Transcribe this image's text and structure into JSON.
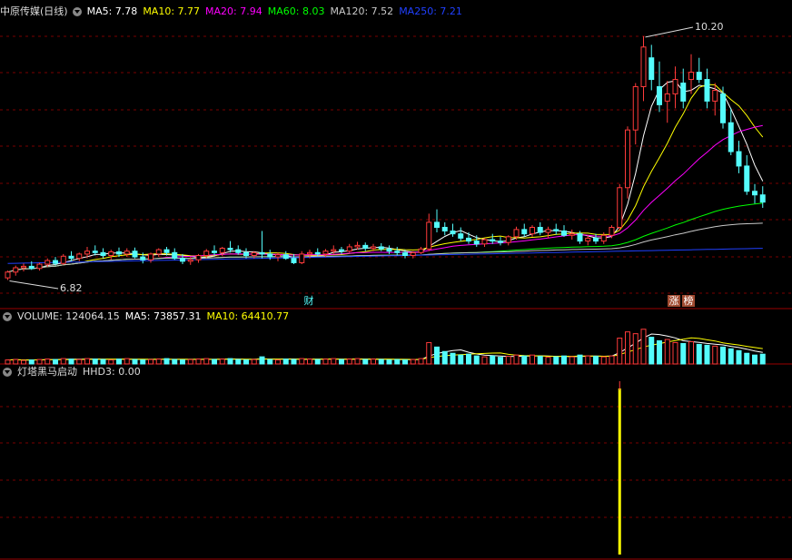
{
  "colors": {
    "up": "#ff3b3b",
    "down": "#54fcfc",
    "ma5": "#ffffff",
    "ma10": "#ffff00",
    "ma20": "#ff00ff",
    "ma60": "#00ff00",
    "ma120": "#c8c8c8",
    "ma250": "#2040ff",
    "grid": "#7a0000",
    "divider": "#9a0000",
    "signal": "#ffff00"
  },
  "price_panel": {
    "stock_name": "中原传媒(日线)",
    "ma5_label": "MA5: 7.78",
    "ma10_label": "MA10: 7.77",
    "ma20_label": "MA20: 7.94",
    "ma60_label": "MA60: 8.03",
    "ma120_label": "MA120: 7.52",
    "ma250_label": "MA250: 7.21",
    "high_mark": "10.20",
    "low_mark": "6.82",
    "event_cai": "财",
    "event_zhang": "涨",
    "event_bang": "榜"
  },
  "volume_panel": {
    "volume_label": "VOLUME: 124064.15",
    "ma5_label": "MA5: 73857.31",
    "ma10_label": "MA10: 64410.77"
  },
  "indicator_panel": {
    "name": "灯塔黑马启动",
    "hhd3_label": "HHD3: 0.00"
  },
  "chart_data": {
    "type": "candlestick",
    "title": "中原传媒(日线)",
    "ylim": [
      6.6,
      10.45
    ],
    "high": 10.2,
    "low": 6.82,
    "candles": [
      [
        6.85,
        6.95,
        6.82,
        6.93
      ],
      [
        6.93,
        7.02,
        6.88,
        6.99
      ],
      [
        6.99,
        7.05,
        6.94,
        7.01
      ],
      [
        7.01,
        7.08,
        6.96,
        6.98
      ],
      [
        6.98,
        7.06,
        6.95,
        7.04
      ],
      [
        7.04,
        7.12,
        7.0,
        7.09
      ],
      [
        7.09,
        7.14,
        7.02,
        7.05
      ],
      [
        7.05,
        7.18,
        7.03,
        7.15
      ],
      [
        7.15,
        7.22,
        7.08,
        7.12
      ],
      [
        7.12,
        7.2,
        7.08,
        7.18
      ],
      [
        7.18,
        7.28,
        7.12,
        7.22
      ],
      [
        7.22,
        7.3,
        7.16,
        7.2
      ],
      [
        7.2,
        7.26,
        7.12,
        7.16
      ],
      [
        7.16,
        7.24,
        7.1,
        7.21
      ],
      [
        7.21,
        7.27,
        7.14,
        7.18
      ],
      [
        7.18,
        7.26,
        7.14,
        7.22
      ],
      [
        7.22,
        7.27,
        7.12,
        7.14
      ],
      [
        7.14,
        7.2,
        7.05,
        7.1
      ],
      [
        7.1,
        7.2,
        7.06,
        7.18
      ],
      [
        7.18,
        7.26,
        7.14,
        7.24
      ],
      [
        7.24,
        7.28,
        7.16,
        7.2
      ],
      [
        7.2,
        7.26,
        7.1,
        7.12
      ],
      [
        7.12,
        7.18,
        7.04,
        7.08
      ],
      [
        7.08,
        7.14,
        7.03,
        7.1
      ],
      [
        7.1,
        7.18,
        7.06,
        7.16
      ],
      [
        7.16,
        7.25,
        7.12,
        7.22
      ],
      [
        7.22,
        7.3,
        7.16,
        7.2
      ],
      [
        7.2,
        7.28,
        7.15,
        7.26
      ],
      [
        7.26,
        7.36,
        7.2,
        7.24
      ],
      [
        7.24,
        7.3,
        7.17,
        7.2
      ],
      [
        7.2,
        7.26,
        7.12,
        7.16
      ],
      [
        7.16,
        7.22,
        7.12,
        7.2
      ],
      [
        7.2,
        7.5,
        7.12,
        7.18
      ],
      [
        7.18,
        7.24,
        7.1,
        7.14
      ],
      [
        7.14,
        7.2,
        7.08,
        7.17
      ],
      [
        7.17,
        7.22,
        7.1,
        7.12
      ],
      [
        7.12,
        7.18,
        7.04,
        7.06
      ],
      [
        7.06,
        7.22,
        7.04,
        7.18
      ],
      [
        7.18,
        7.24,
        7.12,
        7.2
      ],
      [
        7.2,
        7.26,
        7.15,
        7.18
      ],
      [
        7.18,
        7.25,
        7.14,
        7.22
      ],
      [
        7.22,
        7.3,
        7.18,
        7.24
      ],
      [
        7.24,
        7.28,
        7.18,
        7.22
      ],
      [
        7.22,
        7.32,
        7.2,
        7.28
      ],
      [
        7.28,
        7.35,
        7.24,
        7.3
      ],
      [
        7.3,
        7.34,
        7.22,
        7.26
      ],
      [
        7.26,
        7.32,
        7.22,
        7.28
      ],
      [
        7.28,
        7.33,
        7.22,
        7.25
      ],
      [
        7.25,
        7.3,
        7.18,
        7.22
      ],
      [
        7.22,
        7.28,
        7.16,
        7.2
      ],
      [
        7.2,
        7.24,
        7.12,
        7.16
      ],
      [
        7.16,
        7.22,
        7.12,
        7.2
      ],
      [
        7.2,
        7.28,
        7.18,
        7.25
      ],
      [
        7.25,
        7.74,
        7.22,
        7.62
      ],
      [
        7.62,
        7.8,
        7.48,
        7.55
      ],
      [
        7.55,
        7.62,
        7.44,
        7.5
      ],
      [
        7.5,
        7.6,
        7.42,
        7.46
      ],
      [
        7.46,
        7.55,
        7.36,
        7.4
      ],
      [
        7.4,
        7.48,
        7.32,
        7.36
      ],
      [
        7.36,
        7.44,
        7.28,
        7.32
      ],
      [
        7.32,
        7.4,
        7.28,
        7.38
      ],
      [
        7.38,
        7.46,
        7.32,
        7.36
      ],
      [
        7.36,
        7.42,
        7.3,
        7.34
      ],
      [
        7.34,
        7.44,
        7.3,
        7.42
      ],
      [
        7.42,
        7.56,
        7.38,
        7.52
      ],
      [
        7.52,
        7.6,
        7.42,
        7.46
      ],
      [
        7.46,
        7.58,
        7.42,
        7.55
      ],
      [
        7.55,
        7.62,
        7.44,
        7.48
      ],
      [
        7.48,
        7.56,
        7.4,
        7.52
      ],
      [
        7.52,
        7.6,
        7.45,
        7.5
      ],
      [
        7.5,
        7.58,
        7.42,
        7.44
      ],
      [
        7.44,
        7.52,
        7.38,
        7.46
      ],
      [
        7.46,
        7.5,
        7.32,
        7.36
      ],
      [
        7.36,
        7.44,
        7.3,
        7.4
      ],
      [
        7.4,
        7.46,
        7.32,
        7.36
      ],
      [
        7.36,
        7.48,
        7.32,
        7.44
      ],
      [
        7.44,
        7.58,
        7.4,
        7.55
      ],
      [
        7.55,
        8.15,
        7.5,
        8.1
      ],
      [
        8.1,
        8.95,
        7.95,
        8.9
      ],
      [
        8.9,
        9.55,
        8.7,
        9.5
      ],
      [
        9.5,
        10.2,
        9.3,
        10.05
      ],
      [
        9.9,
        10.08,
        9.45,
        9.6
      ],
      [
        9.5,
        9.85,
        9.15,
        9.25
      ],
      [
        9.3,
        9.58,
        9.0,
        9.4
      ],
      [
        9.4,
        9.78,
        9.2,
        9.6
      ],
      [
        9.55,
        9.75,
        9.2,
        9.3
      ],
      [
        9.6,
        9.95,
        9.4,
        9.7
      ],
      [
        9.7,
        9.9,
        9.55,
        9.6
      ],
      [
        9.6,
        9.75,
        9.2,
        9.3
      ],
      [
        9.3,
        9.55,
        9.1,
        9.45
      ],
      [
        9.4,
        9.5,
        8.92,
        9.0
      ],
      [
        9.0,
        9.2,
        8.55,
        8.6
      ],
      [
        8.6,
        8.75,
        8.3,
        8.4
      ],
      [
        8.4,
        8.55,
        8.0,
        8.05
      ],
      [
        8.05,
        8.15,
        7.88,
        8.0
      ],
      [
        8.0,
        8.12,
        7.82,
        7.9
      ]
    ],
    "volume": [
      9,
      10,
      8,
      9,
      10,
      11,
      10,
      12,
      11,
      10,
      12,
      11,
      10,
      9,
      11,
      12,
      10,
      9,
      10,
      11,
      12,
      10,
      9,
      10,
      11,
      12,
      10,
      11,
      12,
      10,
      9,
      10,
      16,
      10,
      9,
      11,
      10,
      12,
      11,
      10,
      11,
      12,
      10,
      11,
      12,
      10,
      11,
      10,
      9,
      10,
      9,
      10,
      12,
      48,
      38,
      28,
      24,
      20,
      22,
      18,
      16,
      18,
      15,
      17,
      20,
      18,
      20,
      17,
      15,
      16,
      18,
      16,
      20,
      18,
      17,
      16,
      18,
      58,
      72,
      68,
      78,
      60,
      52,
      55,
      48,
      46,
      50,
      44,
      42,
      40,
      38,
      34,
      30,
      24,
      20,
      22
    ],
    "hhd3_signal_day": 77,
    "hhd3_value": 0.0
  }
}
